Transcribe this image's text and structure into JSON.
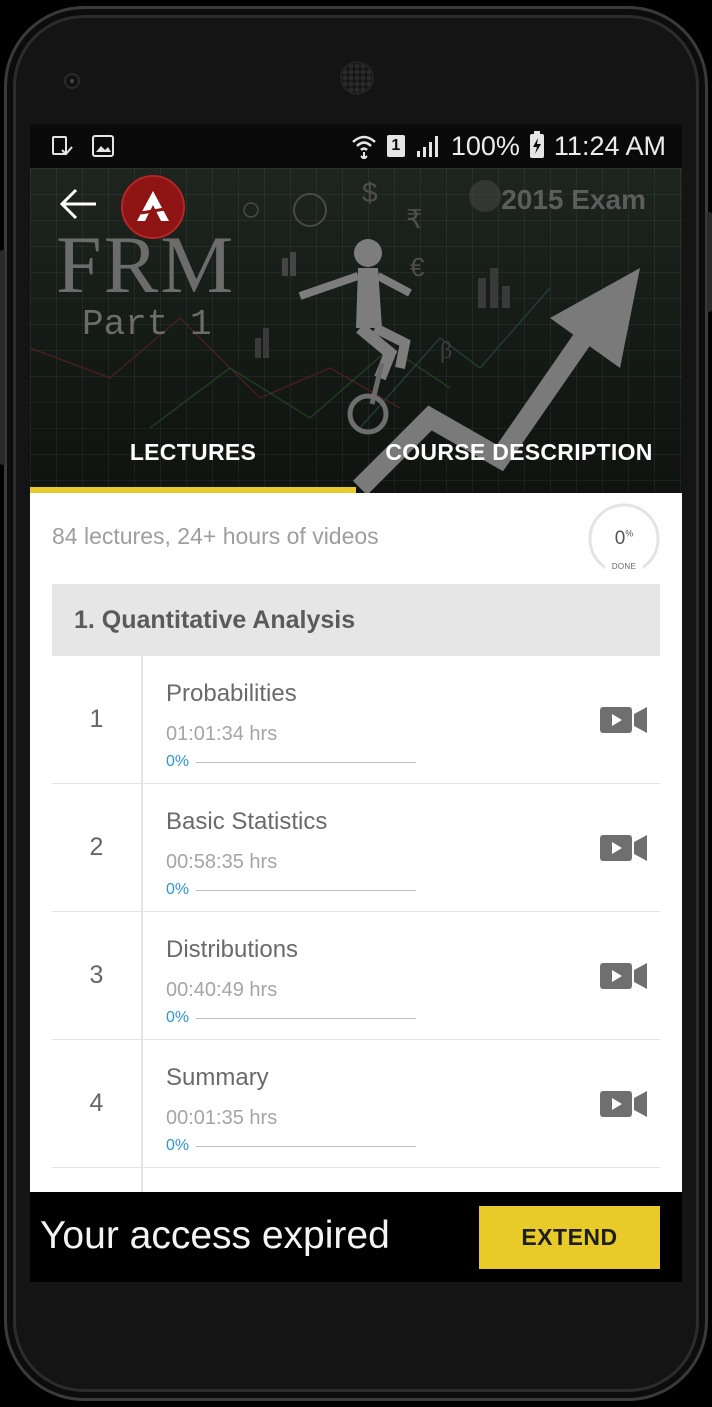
{
  "status_bar": {
    "battery_text": "100%",
    "time": "11:24 AM",
    "sim_slot": "1",
    "left_icons": [
      "notification-screenshot-icon",
      "notification-image-icon"
    ],
    "right_icons": [
      "wifi-icon",
      "sim-icon",
      "signal-icon",
      "battery-charging-icon"
    ]
  },
  "header": {
    "banner_title": "FRM",
    "banner_subtitle": "Part 1",
    "banner_exam": "2015 Exam",
    "back_icon": "arrow-left-icon",
    "logo_icon": "brand-logo-icon"
  },
  "tabs": [
    {
      "label": "LECTURES",
      "active": true
    },
    {
      "label": "COURSE DESCRIPTION",
      "active": false
    }
  ],
  "colors": {
    "accent": "#e8cb28",
    "progress": "#2f97d6",
    "logo_red": "#8f1414"
  },
  "course": {
    "summary": "84 lectures, 24+ hours of videos",
    "overall_progress": {
      "value": "0",
      "unit": "%",
      "label": "DONE",
      "fraction": 0
    }
  },
  "section": {
    "title": "1. Quantitative Analysis",
    "lectures": [
      {
        "number": "1",
        "title": "Probabilities",
        "duration": "01:01:34 hrs",
        "progress_text": "0%",
        "progress": 0,
        "icon": "video-camera-icon"
      },
      {
        "number": "2",
        "title": "Basic Statistics",
        "duration": "00:58:35 hrs",
        "progress_text": "0%",
        "progress": 0,
        "icon": "video-camera-icon"
      },
      {
        "number": "3",
        "title": "Distributions",
        "duration": "00:40:49 hrs",
        "progress_text": "0%",
        "progress": 0,
        "icon": "video-camera-icon"
      },
      {
        "number": "4",
        "title": "Summary",
        "duration": "00:01:35 hrs",
        "progress_text": "0%",
        "progress": 0,
        "icon": "video-camera-icon"
      }
    ]
  },
  "footer": {
    "message": "Your access expired",
    "extend_label": "EXTEND"
  }
}
